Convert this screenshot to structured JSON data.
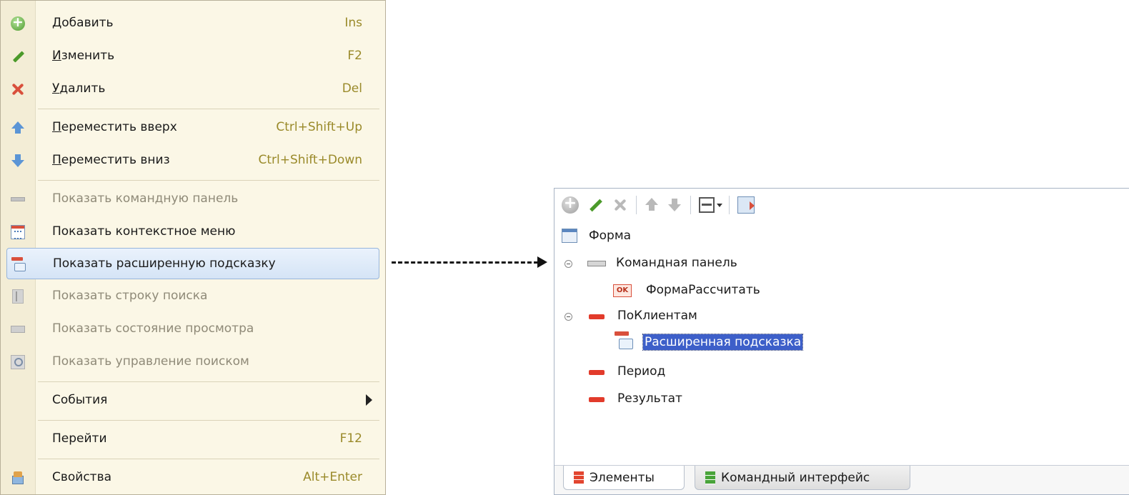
{
  "context_menu": {
    "items": [
      {
        "pre": "",
        "u": "Д",
        "post": "обавить",
        "shortcut": "Ins",
        "icon": "add-icon"
      },
      {
        "pre": "",
        "u": "И",
        "post": "зменить",
        "shortcut": "F2",
        "icon": "pencil-icon"
      },
      {
        "pre": "",
        "u": "У",
        "post": "далить",
        "shortcut": "Del",
        "icon": "delete-icon"
      },
      {
        "pre": "",
        "u": "П",
        "post": "ереместить вверх",
        "shortcut": "Ctrl+Shift+Up",
        "icon": "arrow-up-icon"
      },
      {
        "pre": "",
        "u": "П",
        "post": "ереместить вниз",
        "shortcut": "Ctrl+Shift+Down",
        "icon": "arrow-down-icon"
      },
      {
        "label": "Показать командную панель",
        "icon": "command-panel-icon",
        "disabled": true
      },
      {
        "label": "Показать контекстное меню",
        "icon": "context-menu-icon"
      },
      {
        "label": "Показать расширенную подсказку",
        "icon": "extended-tooltip-icon",
        "selected": true
      },
      {
        "label": "Показать строку поиска",
        "icon": "search-string-icon",
        "disabled": true
      },
      {
        "label": "Показать состояние просмотра",
        "icon": "view-state-icon",
        "disabled": true
      },
      {
        "label": "Показать управление поиском",
        "icon": "search-control-icon",
        "disabled": true
      },
      {
        "label": "События",
        "icon": "",
        "submenu": true
      },
      {
        "label": "Перейти",
        "shortcut": "F12",
        "icon": ""
      },
      {
        "label": "Свойства",
        "shortcut": "Alt+Enter",
        "icon": "properties-icon"
      }
    ]
  },
  "elements_panel": {
    "toolbar": [
      "add-icon",
      "pencil-icon",
      "delete-icon",
      "arrow-up-icon",
      "arrow-down-icon",
      "view-mode-icon",
      "dropdown-icon",
      "menu-icon"
    ],
    "tree": [
      {
        "label": "Форма",
        "icon": "form-icon"
      },
      {
        "label": "Командная панель",
        "icon": "command-panel-icon",
        "expanded": true
      },
      {
        "label": "ФормаРассчитать",
        "icon": "ok-button-icon",
        "icon_text": "OK"
      },
      {
        "label": "ПоКлиентам",
        "icon": "group-icon",
        "expanded": true
      },
      {
        "label": "Расширенная подсказка",
        "icon": "extended-tooltip-icon",
        "selected": true
      },
      {
        "label": "Период",
        "icon": "field-icon"
      },
      {
        "label": "Результат",
        "icon": "field-icon"
      }
    ],
    "tabs": [
      {
        "label": "Элементы",
        "active": true
      },
      {
        "label": "Командный интерфейс",
        "active": false
      }
    ]
  },
  "colors": {
    "menu_bg": "#fbf7e6",
    "shortcut": "#9a8a2a",
    "selection": "#3d5fc9",
    "accent_red": "#e23b2b"
  }
}
